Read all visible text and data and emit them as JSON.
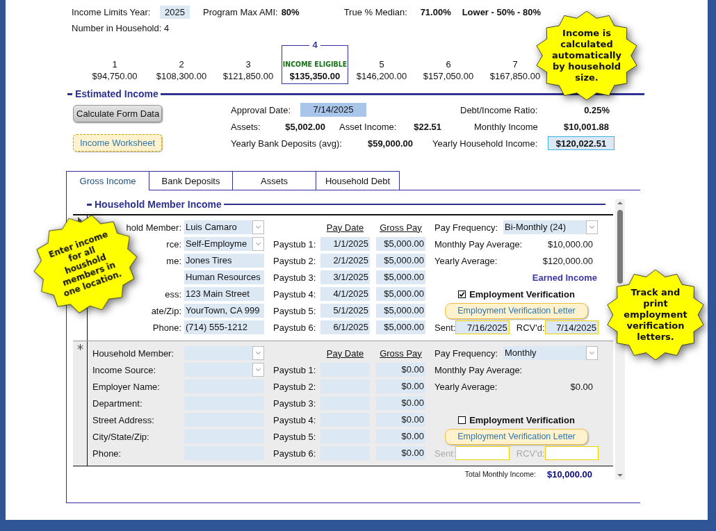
{
  "top": {
    "year_label": "Income Limits Year:",
    "year": "2025",
    "ami_label": "Program Max AMI:",
    "ami": "80%",
    "median_label": "True % Median:",
    "median": "71.00%",
    "category": "Lower - 50% - 80%",
    "household_count": "Number in Household: 4"
  },
  "limits": {
    "eligible_label": "INCOME ELIGIBLE",
    "items": [
      {
        "size": "1",
        "amount": "$94,750.00",
        "selected": false
      },
      {
        "size": "2",
        "amount": "$108,300.00",
        "selected": false
      },
      {
        "size": "3",
        "amount": "$121,850.00",
        "selected": false
      },
      {
        "size": "4",
        "amount": "$135,350.00",
        "selected": true
      },
      {
        "size": "5",
        "amount": "$146,200.00",
        "selected": false
      },
      {
        "size": "6",
        "amount": "$157,050.00",
        "selected": false
      },
      {
        "size": "7",
        "amount": "$167,850.00",
        "selected": false
      }
    ]
  },
  "estimated": {
    "title": "Estimated Income",
    "buttons": [
      {
        "label": "Calculate Form Data",
        "kind": "gray"
      },
      {
        "label": "Income Worksheet",
        "kind": "gold"
      }
    ],
    "approval_label": "Approval Date:",
    "approval": "7/14/2025",
    "ratio_label": "Debt/Income Ratio:",
    "ratio": "0.25%",
    "assets_label": "Assets:",
    "assets": "$5,002.00",
    "asset_income_label": "Asset Income:",
    "asset_income": "$22.51",
    "monthly_label": "Monthly Income",
    "monthly": "$10,001.88",
    "deposits_label": "Yearly Bank Deposits (avg):",
    "deposits": "$59,000.00",
    "yearly_label": "Yearly Household Income:",
    "yearly": "$120,022.51"
  },
  "tabs": [
    {
      "label": "Gross Income",
      "selected": true
    },
    {
      "label": "Bank Deposits",
      "selected": false
    },
    {
      "label": "Assets",
      "selected": false
    },
    {
      "label": "Household Debt",
      "selected": false
    }
  ],
  "member_income": {
    "title": "Household Member Income",
    "records": [
      {
        "kind": "current",
        "labels_covered": true,
        "fields": [
          {
            "label": "hold Member:",
            "value": "Luis Camaro",
            "dropdown": true
          },
          {
            "label": "rce:",
            "value": "Self-Employme",
            "dropdown": true
          },
          {
            "label": "me:",
            "value": "Jones Tires",
            "dropdown": false
          },
          {
            "value": "Human Resources",
            "dropdown": false
          },
          {
            "label": "ess:",
            "value": "123 Main Street",
            "dropdown": false
          },
          {
            "label": "ate/Zip:",
            "value": "YourTown, CA 999",
            "dropdown": false
          },
          {
            "label": "Phone:",
            "value": "(714) 555-1212",
            "dropdown": false
          }
        ],
        "pay_date_header": "Pay Date",
        "gross_pay_header": "Gross Pay",
        "paystubs": [
          {
            "label": "Paystub 1:",
            "date": "1/1/2025",
            "gross": "$5,000.00"
          },
          {
            "label": "Paystub 2:",
            "date": "2/1/2025",
            "gross": "$5,000.00"
          },
          {
            "label": "Paystub 3:",
            "date": "3/1/2025",
            "gross": "$5,000.00"
          },
          {
            "label": "Paystub 4:",
            "date": "4/1/2025",
            "gross": "$5,000.00"
          },
          {
            "label": "Paystub 5:",
            "date": "5/1/2025",
            "gross": "$5,000.00"
          },
          {
            "label": "Paystub 6:",
            "date": "6/1/2025",
            "gross": "$5,000.00"
          }
        ],
        "frequency_label": "Pay Frequency:",
        "frequency": "Bi-Monthly (24)",
        "monthly_label": "Monthly Pay Average:",
        "monthly": "$10,000.00",
        "yearly_label": "Yearly Average:",
        "yearly": "$120,000.00",
        "earned_income": "Earned Income",
        "verification": {
          "label": "Employment Verification",
          "checked": true
        },
        "letter_button": "Employment Verification Letter",
        "sent_label": "Sent:",
        "sent": "7/16/2025",
        "rcvd_label": "RCV'd:",
        "rcvd": "7/14/2025",
        "dates_disabled": false
      },
      {
        "kind": "new",
        "labels_covered": false,
        "fields": [
          {
            "label": "Household Member:",
            "dropdown": true
          },
          {
            "label": "Income Source:",
            "dropdown": true
          },
          {
            "label": "Employer Name:",
            "dropdown": false
          },
          {
            "label": "Department:",
            "dropdown": false
          },
          {
            "label": "Street Address:",
            "dropdown": false
          },
          {
            "label": "City/State/Zip:",
            "dropdown": false
          },
          {
            "label": "Phone:",
            "dropdown": false
          }
        ],
        "pay_date_header": "Pay Date",
        "gross_pay_header": "Gross Pay",
        "paystubs": [
          {
            "label": "Paystub 1:",
            "gross": "$0.00"
          },
          {
            "label": "Paystub 2:",
            "gross": "$0.00"
          },
          {
            "label": "Paystub 3:",
            "gross": "$0.00"
          },
          {
            "label": "Paystub 4:",
            "gross": "$0.00"
          },
          {
            "label": "Paystub 5:",
            "gross": "$0.00"
          },
          {
            "label": "Paystub 6:",
            "gross": "$0.00"
          }
        ],
        "frequency_label": "Pay Frequency:",
        "frequency": "Monthly",
        "monthly_label": "Monthly Pay Average:",
        "yearly_label": "Yearly Average:",
        "yearly": "$0.00",
        "verification": {
          "label": "Employment Verification",
          "checked": false
        },
        "letter_button": "Employment Verification Letter",
        "sent_label": "Sent:",
        "rcvd_label": "RCV'd:",
        "dates_disabled": true
      }
    ],
    "total_label": "Total Monthly Income:",
    "total": "$10,000.00"
  },
  "callouts": [
    {
      "text": "Income is calculated automatically by household size."
    },
    {
      "text": "Enter income for all houshold members in one location."
    },
    {
      "text": "Track and print employment verification letters."
    }
  ]
}
